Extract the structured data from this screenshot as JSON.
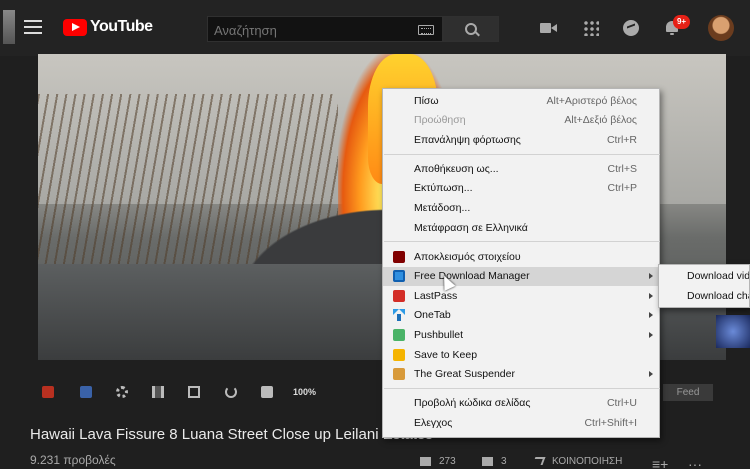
{
  "header": {
    "logo_text": "YouTube",
    "search_placeholder": "Αναζήτηση",
    "notification_count": "9+",
    "colors": {
      "brand_red": "#ff0000",
      "badge_red": "#e62117"
    }
  },
  "player": {
    "zoom_label": "100%",
    "feed_label": "Feed"
  },
  "video": {
    "title": "Hawaii Lava Fissure 8 Luana Street Close up Leilani Estates",
    "views": "9.231 προβολές",
    "likes": "273",
    "dislikes": "3",
    "share_label": "ΚΟΙΝΟΠΟΙΗΣΗ"
  },
  "context_menu": {
    "items": [
      {
        "label": "Πίσω",
        "shortcut": "Alt+Αριστερό βέλος",
        "disabled": false
      },
      {
        "label": "Προώθηση",
        "shortcut": "Alt+Δεξιό βέλος",
        "disabled": true
      },
      {
        "label": "Επανάληψη φόρτωσης",
        "shortcut": "Ctrl+R",
        "disabled": false
      },
      {
        "label": "Αποθήκευση ως...",
        "shortcut": "Ctrl+S",
        "disabled": false
      },
      {
        "label": "Εκτύπωση...",
        "shortcut": "Ctrl+P",
        "disabled": false
      },
      {
        "label": "Μετάδοση...",
        "shortcut": "",
        "disabled": false
      },
      {
        "label": "Μετάφραση σε Ελληνικά",
        "shortcut": "",
        "disabled": false
      },
      {
        "label": "Αποκλεισμός στοιχείου",
        "icon": "ublock-icon"
      },
      {
        "label": "Free Download Manager",
        "icon": "fdm-icon",
        "submenu": true
      },
      {
        "label": "LastPass",
        "icon": "lastpass-icon",
        "submenu": true
      },
      {
        "label": "OneTab",
        "icon": "onetab-icon",
        "submenu": true
      },
      {
        "label": "Pushbullet",
        "icon": "pushbullet-icon",
        "submenu": true
      },
      {
        "label": "Save to Keep",
        "icon": "save-to-keep-icon"
      },
      {
        "label": "The Great Suspender",
        "icon": "great-suspender-icon",
        "submenu": true
      },
      {
        "label": "Προβολή κώδικα σελίδας",
        "shortcut": "Ctrl+U"
      },
      {
        "label": "Ελεγχος",
        "shortcut": "Ctrl+Shift+I"
      }
    ]
  },
  "submenu": {
    "items": [
      {
        "label": "Download video"
      },
      {
        "label": "Download channel"
      }
    ]
  }
}
